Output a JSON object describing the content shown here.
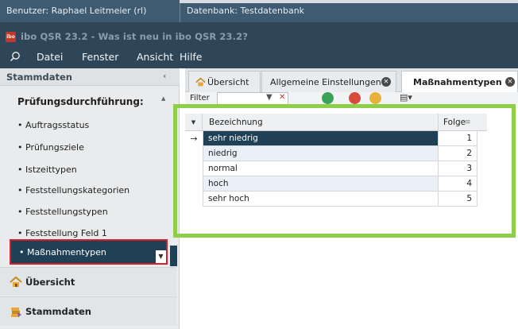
{
  "statusbar": {
    "user": "Benutzer: Raphael Leitmeier (rl)",
    "database": "Datenbank: Testdatenbank"
  },
  "window": {
    "logo": "ibo",
    "title": "ibo QSR 23.2 - Was ist neu in ibo QSR 23.2?"
  },
  "menu": {
    "items": [
      "Datei",
      "Fenster",
      "Ansicht",
      "Hilfe"
    ]
  },
  "sidebar": {
    "header": "Stammdaten",
    "collapse_glyph": "‹",
    "group_title": "Prüfungsdurchführung:",
    "items": [
      {
        "label": "Auftragsstatus"
      },
      {
        "label": "Prüfungsziele"
      },
      {
        "label": "Istzeittypen"
      },
      {
        "label": "Feststellungskategorien"
      },
      {
        "label": "Feststellungstypen"
      },
      {
        "label": "Feststellung Feld 1"
      },
      {
        "label": "Maßnahmentypen"
      }
    ],
    "nav_buttons": [
      {
        "label": "Übersicht",
        "icon": "home-icon"
      },
      {
        "label": "Stammdaten",
        "icon": "stack-icon"
      }
    ]
  },
  "tabs": [
    {
      "label": "Übersicht",
      "icon": "home-icon",
      "closable": false
    },
    {
      "label": "Allgemeine Einstellungen",
      "closable": true
    },
    {
      "label": "Maßnahmentypen",
      "closable": true,
      "active": true
    }
  ],
  "toolbar": {
    "filter_label": "Filter",
    "icons": [
      "add-icon",
      "delete-icon",
      "info-icon",
      "print-icon"
    ]
  },
  "grid": {
    "columns": {
      "name": "Bezeichnung",
      "sequence": "Folge"
    },
    "rows": [
      {
        "name": "sehr niedrig",
        "sequence": "1",
        "selected": true
      },
      {
        "name": "niedrig",
        "sequence": "2"
      },
      {
        "name": "normal",
        "sequence": "3"
      },
      {
        "name": "hoch",
        "sequence": "4"
      },
      {
        "name": "sehr hoch",
        "sequence": "5"
      }
    ]
  },
  "colors": {
    "accent_dark": "#1f4055",
    "highlight_green": "#8fce4a",
    "selection_red": "#d0202d"
  }
}
